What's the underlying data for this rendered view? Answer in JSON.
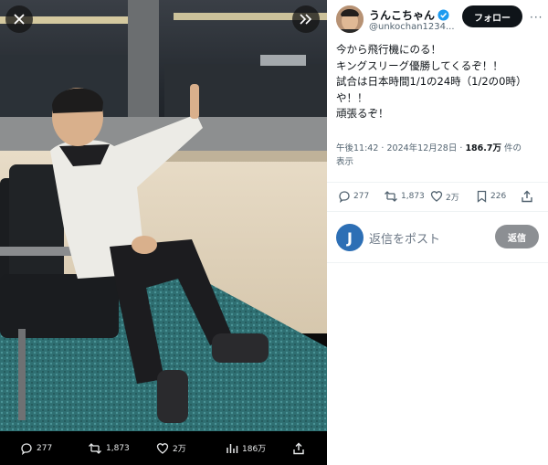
{
  "user": {
    "display_name": "うんこちゃん",
    "handle": "@unkochan1234...",
    "follow_label": "フォロー",
    "more_label": "···"
  },
  "tweet": {
    "lines": [
      "今から飛行機にのる！",
      "キングスリーグ優勝してくるぞ！！",
      "試合は日本時間1/1の24時（1/2の0時）",
      "や！！",
      "頑張るぞ！"
    ],
    "time": "午後11:42",
    "date": "2024年12月28日",
    "sep": "·",
    "views_count": "186.7万",
    "views_suffix": "件の",
    "views_label": "表示"
  },
  "actions": {
    "replies": "277",
    "reposts": "1,873",
    "likes": "2万",
    "bookmarks": "226"
  },
  "media_bar": {
    "replies": "277",
    "reposts": "1,873",
    "likes": "2万",
    "views": "186万"
  },
  "reply_box": {
    "avatar_letter": "J",
    "placeholder": "返信をポスト",
    "button_label": "返信"
  },
  "colors": {
    "verified": "#1d9bf0",
    "follow_bg": "#0f1419",
    "reply_button_bg": "#8c8f93"
  },
  "icons": [
    "close-icon",
    "expand-icon",
    "reply-icon",
    "repost-icon",
    "like-icon",
    "views-icon",
    "share-icon",
    "bookmark-icon",
    "verified-badge-icon"
  ]
}
